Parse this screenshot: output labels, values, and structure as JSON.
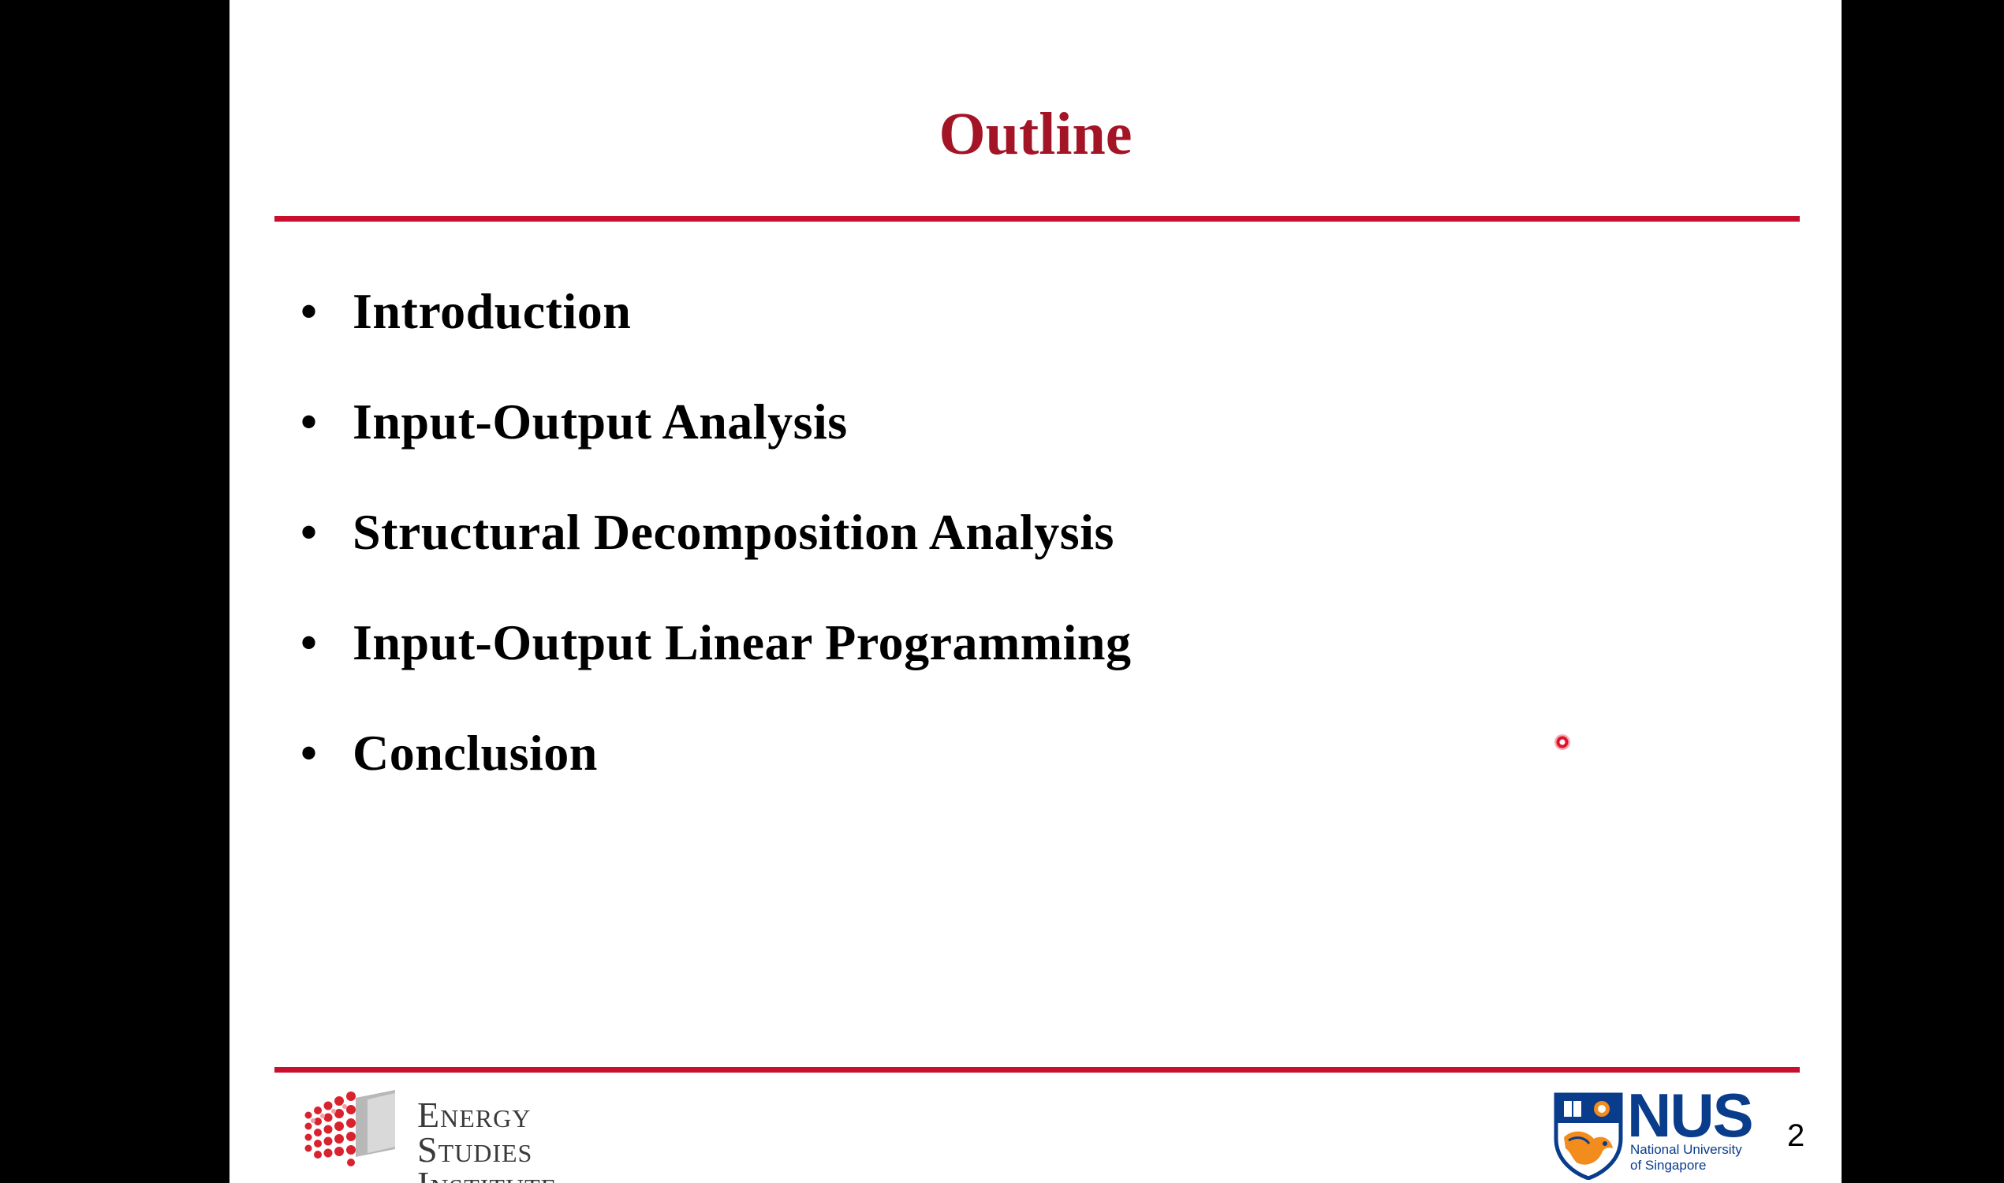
{
  "slide": {
    "title": "Outline",
    "bullets": [
      "Introduction",
      "Input-Output Analysis",
      "Structural Decomposition Analysis",
      "Input-Output Linear Programming",
      "Conclusion"
    ],
    "bullet_symbol": "•",
    "page_number": "2"
  },
  "footer": {
    "left_logo": {
      "lines": [
        "Energy",
        "Studies",
        "Institute"
      ]
    },
    "right_logo": {
      "abbrev": "NUS",
      "fullname_line1": "National University",
      "fullname_line2": "of Singapore"
    }
  },
  "colors": {
    "title": "#a31526",
    "rule": "#c8102e",
    "nus_blue": "#0a3c8c",
    "background": "#000000",
    "slide": "#ffffff"
  },
  "icons": {
    "pointer": "laser-pointer-dot",
    "esi_mark": "dot-grid-cube-icon",
    "nus_crest": "lion-shield-crest-icon"
  }
}
